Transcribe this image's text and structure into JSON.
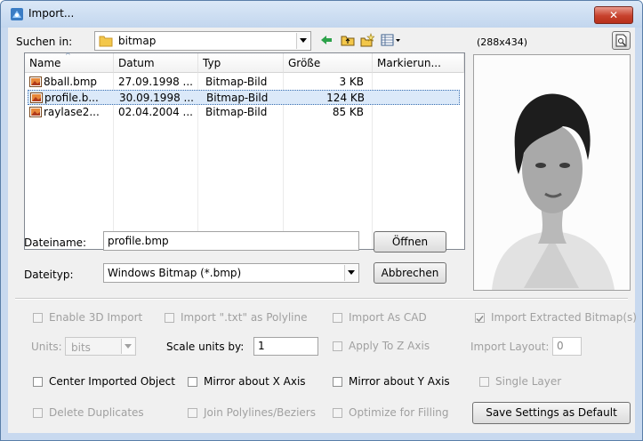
{
  "window": {
    "title": "Import...",
    "close_label": "✕"
  },
  "toolbar": {
    "look_in_label": "Suchen in:",
    "folder": "bitmap",
    "preview_size": "(288x434)"
  },
  "file_list": {
    "columns": [
      "Name",
      "Datum",
      "Typ",
      "Größe",
      "Markierun..."
    ],
    "rows": [
      {
        "name": "8ball.bmp",
        "date": "27.09.1998 ...",
        "type": "Bitmap-Bild",
        "size": "3 KB"
      },
      {
        "name": "profile.b...",
        "date": "30.09.1998 ...",
        "type": "Bitmap-Bild",
        "size": "124 KB"
      },
      {
        "name": "raylase2...",
        "date": "02.04.2004 ...",
        "type": "Bitmap-Bild",
        "size": "85 KB"
      }
    ]
  },
  "filename": {
    "label": "Dateiname:",
    "value": "profile.bmp",
    "open_button": "Öffnen"
  },
  "filetype": {
    "label": "Dateityp:",
    "value": "Windows Bitmap (*.bmp)",
    "cancel_button": "Abbrechen"
  },
  "options": {
    "enable_3d": "Enable 3D Import",
    "import_txt": "Import \".txt\" as Polyline",
    "import_cad": "Import As CAD",
    "import_extracted": "Import Extracted Bitmap(s)",
    "units_label": "Units:",
    "units_value": "bits",
    "scale_label": "Scale units by:",
    "scale_value": "1",
    "apply_z": "Apply To Z Axis",
    "import_layout_label": "Import Layout:",
    "import_layout_value": "0",
    "center": "Center Imported Object",
    "mirror_x": "Mirror about X Axis",
    "mirror_y": "Mirror about Y Axis",
    "single_layer": "Single Layer",
    "delete_dup": "Delete Duplicates",
    "join_poly": "Join Polylines/Beziers",
    "optimize": "Optimize for Filling",
    "save_default": "Save Settings as Default"
  }
}
